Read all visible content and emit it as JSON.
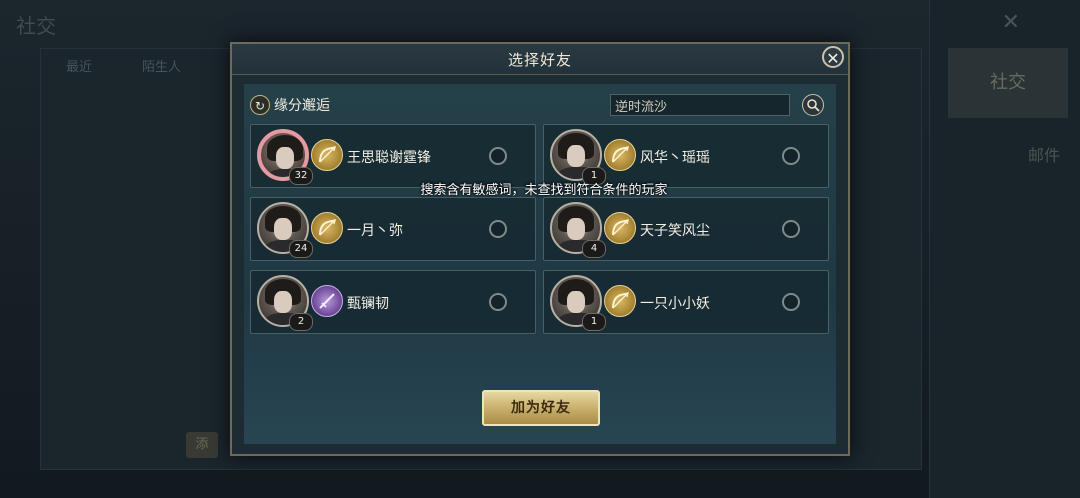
{
  "background": {
    "title": "社交",
    "tabs": [
      "最近",
      "陌生人"
    ],
    "right_tab": "社交",
    "right_tab2": "邮件",
    "small_button": "添"
  },
  "dialog": {
    "title": "选择好友",
    "close_icon": "close-icon",
    "fate_label": "缘分邂逅",
    "search_value": "逆时流沙",
    "toast": "搜索含有敏感词，未查找到符合条件的玩家",
    "add_button": "加为好友"
  },
  "friends": [
    {
      "name": "王思聪谢霆锋",
      "level": "32",
      "class_icon": "bow-icon",
      "selected": false
    },
    {
      "name": "风华丶瑶瑶",
      "level": "1",
      "class_icon": "bow-icon",
      "selected": false
    },
    {
      "name": "一月丶弥",
      "level": "24",
      "class_icon": "bow-icon",
      "selected": false
    },
    {
      "name": "天子笑风尘",
      "level": "4",
      "class_icon": "bow-icon",
      "selected": false
    },
    {
      "name": "甄镧韧",
      "level": "2",
      "class_icon": "sword-icon",
      "selected": false
    },
    {
      "name": "一只小小妖",
      "level": "1",
      "class_icon": "bow-icon",
      "selected": false
    }
  ],
  "colors": {
    "accent_gold": "#c9b06c",
    "panel_bg": "#1f3944",
    "special_avatar_border": "#e59aa3"
  }
}
